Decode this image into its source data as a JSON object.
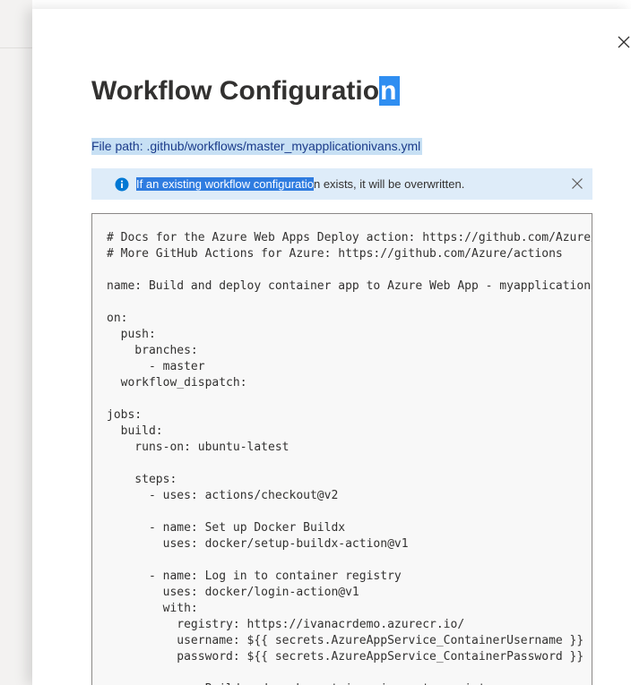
{
  "dialog": {
    "title_main": "Workflow Configuratio",
    "title_selected": "n",
    "file_path": "File path: .github/workflows/master_myapplicationivans.yml",
    "info": {
      "selected_text": "If an existing workflow configuratio",
      "rest_text": "n exists, it will be overwritten."
    }
  },
  "code_lines": [
    "# Docs for the Azure Web Apps Deploy action: https://github.com/Azure/webapps-deploy",
    "# More GitHub Actions for Azure: https://github.com/Azure/actions",
    "",
    "name: Build and deploy container app to Azure Web App - myapplicationivans",
    "",
    "on:",
    "  push:",
    "    branches:",
    "      - master",
    "  workflow_dispatch:",
    "",
    "jobs:",
    "  build:",
    "    runs-on: ubuntu-latest",
    "",
    "    steps:",
    "      - uses: actions/checkout@v2",
    "",
    "      - name: Set up Docker Buildx",
    "        uses: docker/setup-buildx-action@v1",
    "",
    "      - name: Log in to container registry",
    "        uses: docker/login-action@v1",
    "        with:",
    "          registry: https://ivanacrdemo.azurecr.io/",
    "          username: ${{ secrets.AzureAppService_ContainerUsername }}",
    "          password: ${{ secrets.AzureAppService_ContainerPassword }}",
    "",
    "      - name: Build and push container image to registry"
  ],
  "icons": {
    "close": "close-icon",
    "info": "info-icon",
    "dismiss": "dismiss-icon"
  },
  "colors": {
    "selection": "#2f8ef1",
    "filepath_highlight": "#c7e0f4",
    "info_bar": "#deecf9",
    "info_icon": "#0078d4"
  }
}
